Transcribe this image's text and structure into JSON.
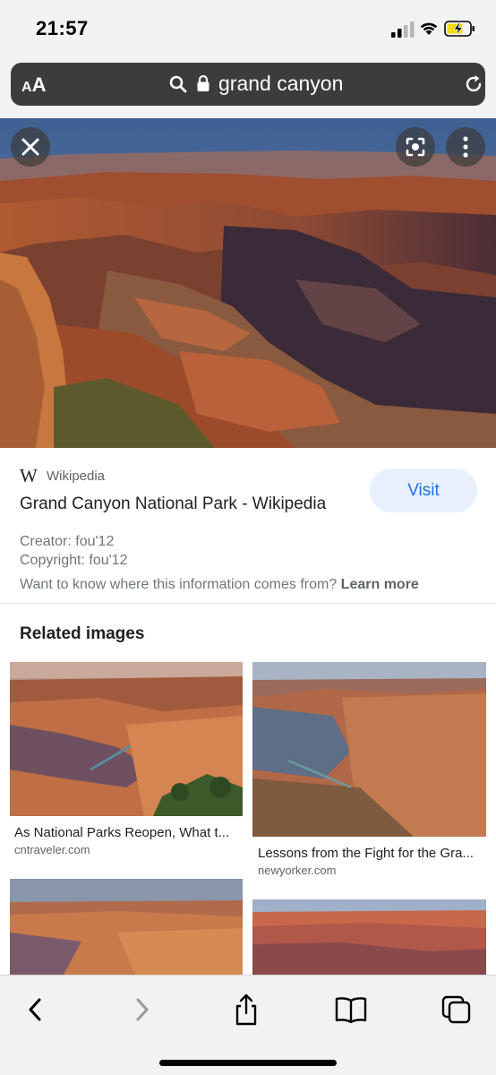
{
  "status_bar": {
    "time": "21:57"
  },
  "address_bar": {
    "aa_small": "A",
    "aa_big": "A",
    "query": "grand canyon"
  },
  "result": {
    "source": "Wikipedia",
    "source_logo": "W",
    "title": "Grand Canyon National Park - Wikipedia",
    "visit_label": "Visit",
    "creator": "Creator: fou'12",
    "copyright": "Copyright: fou'12",
    "info_question": "Want to know where this information comes from?",
    "learn_more": "Learn more"
  },
  "related": {
    "heading": "Related images",
    "items": [
      {
        "caption": "As National Parks Reopen, What t...",
        "domain": "cntraveler.com"
      },
      {
        "caption": "Lessons from the Fight for the Gra...",
        "domain": "newyorker.com"
      }
    ]
  },
  "icons": {
    "close": "close-icon",
    "lens": "lens-icon",
    "more": "more-vert-icon",
    "search": "search-icon",
    "lock": "lock-icon",
    "reload": "reload-icon",
    "back": "chevron-left-icon",
    "forward": "chevron-right-icon",
    "share": "share-icon",
    "bookmarks": "book-icon",
    "tabs": "tabs-icon"
  },
  "colors": {
    "visit_bg": "#e8f0fe",
    "visit_text": "#1a73e8",
    "address_bg": "#3c3c3e",
    "battery_fill": "#f5d90a"
  }
}
